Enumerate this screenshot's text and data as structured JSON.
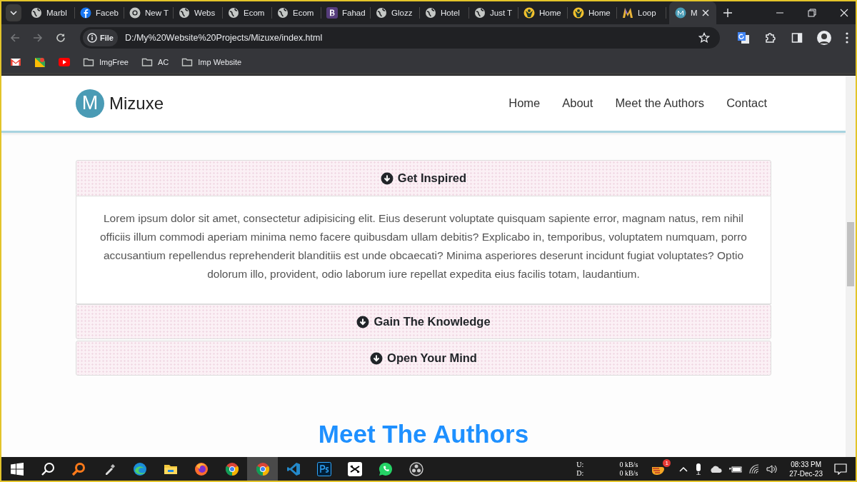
{
  "browser": {
    "tabs": [
      {
        "label": "Marbl",
        "kind": "globe",
        "selected": false
      },
      {
        "label": "Faceb",
        "kind": "facebook",
        "selected": false
      },
      {
        "label": "New T",
        "kind": "chrome",
        "selected": false
      },
      {
        "label": "Webs",
        "kind": "globe",
        "selected": false
      },
      {
        "label": "Ecom",
        "kind": "globe",
        "selected": false
      },
      {
        "label": "Ecom",
        "kind": "globe",
        "selected": false
      },
      {
        "label": "Fahad",
        "kind": "letter-b",
        "selected": false
      },
      {
        "label": "Glozz",
        "kind": "globe",
        "selected": false
      },
      {
        "label": "Hotel",
        "kind": "globe",
        "selected": false
      },
      {
        "label": "Just T",
        "kind": "globe",
        "selected": false
      },
      {
        "label": "Home",
        "kind": "figure",
        "selected": false
      },
      {
        "label": "Home",
        "kind": "figure",
        "selected": false
      },
      {
        "label": "Loop",
        "kind": "letter-m",
        "selected": false
      },
      {
        "label": "M",
        "kind": "site",
        "selected": true
      }
    ],
    "address": {
      "chip": "File",
      "url": "D:/My%20Website%20Projects/Mizuxe/index.html"
    },
    "bookmarks": [
      {
        "kind": "mail"
      },
      {
        "kind": "maps"
      },
      {
        "kind": "video"
      },
      {
        "kind": "folder",
        "label": "ImgFree"
      },
      {
        "kind": "folder",
        "label": "AC"
      },
      {
        "kind": "folder",
        "label": "Imp Website"
      }
    ]
  },
  "page": {
    "navbar": {
      "logo_letter": "M",
      "brand": "Mizuxe",
      "links": [
        {
          "label": "Home"
        },
        {
          "label": "About"
        },
        {
          "label": "Meet the Authors"
        },
        {
          "label": "Contact"
        }
      ]
    },
    "accordion": [
      {
        "title": "Get Inspired",
        "expanded": true,
        "body": "Lorem ipsum dolor sit amet, consectetur adipisicing elit. Eius deserunt voluptate quisquam sapiente error, magnam natus, rem nihil officiis illum commodi aperiam minima nemo facere quibusdam ullam debitis? Explicabo in, temporibus, voluptatem numquam, porro accusantium repellendus reprehenderit blanditiis est unde obcaecati? Minima asperiores deserunt incidunt fugiat voluptates? Optio dolorum illo, provident, odio laborum iure repellat expedita eius facilis totam, laudantium."
      },
      {
        "title": "Gain The Knowledge",
        "expanded": false
      },
      {
        "title": "Open Your Mind",
        "expanded": false
      }
    ],
    "section_heading": "Meet The Authors"
  },
  "taskbar": {
    "apps": [
      {
        "kind": "start",
        "selected": false
      },
      {
        "kind": "search",
        "selected": false
      },
      {
        "kind": "magnifier",
        "selected": false
      },
      {
        "kind": "picker",
        "selected": false
      },
      {
        "kind": "edge",
        "selected": false
      },
      {
        "kind": "files",
        "selected": false
      },
      {
        "kind": "firefox",
        "selected": false
      },
      {
        "kind": "chrome",
        "selected": false
      },
      {
        "kind": "chrome",
        "selected": true
      },
      {
        "kind": "code",
        "selected": false
      },
      {
        "kind": "ps",
        "selected": false
      },
      {
        "kind": "capcut",
        "selected": false
      },
      {
        "kind": "chat",
        "selected": false
      },
      {
        "kind": "obs",
        "selected": false
      }
    ],
    "net": {
      "up_label": "U:",
      "down_label": "D:",
      "up_rate": "0 kB/s",
      "down_rate": "0 kB/s"
    },
    "notification_count": "1",
    "time": "08:33 PM",
    "date": "27-Dec-23"
  }
}
